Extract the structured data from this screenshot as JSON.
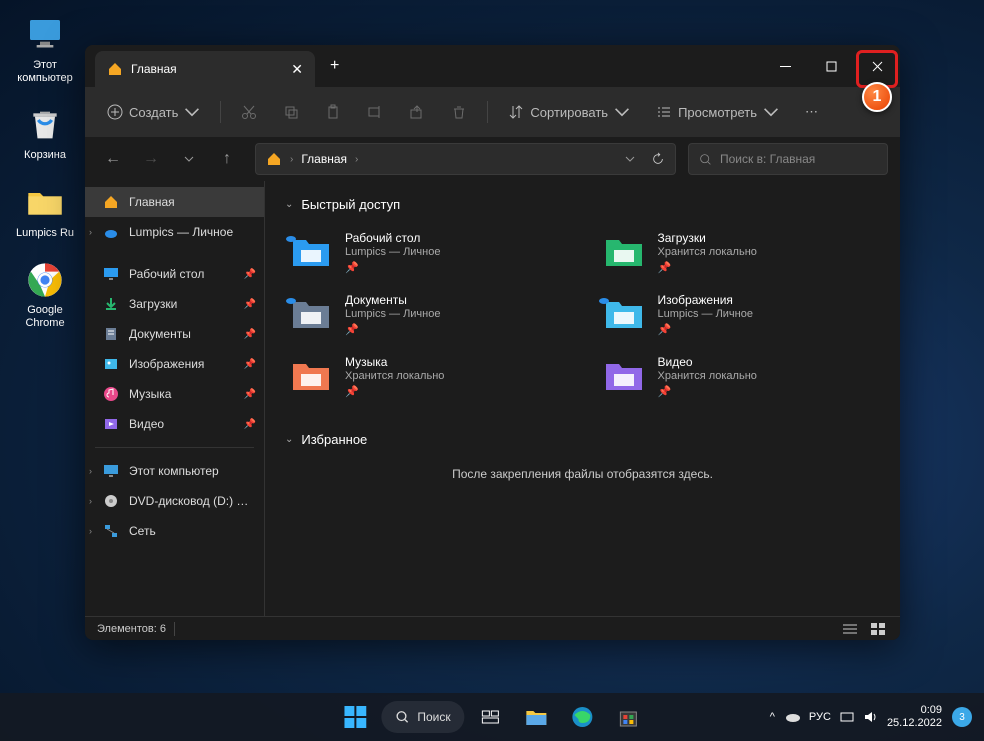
{
  "desktop": {
    "icons": [
      {
        "label": "Этот\nкомпьютер"
      },
      {
        "label": "Корзина"
      },
      {
        "label": "Lumpics Ru"
      },
      {
        "label": "Google\nChrome"
      }
    ]
  },
  "window": {
    "tab_title": "Главная",
    "toolbar": {
      "create": "Создать",
      "sort": "Сортировать",
      "view": "Просмотреть"
    },
    "breadcrumb": "Главная",
    "search_placeholder": "Поиск в: Главная",
    "status": "Элементов: 6"
  },
  "sidebar": {
    "home": "Главная",
    "onedrive": "Lumpics — Личное",
    "desktop": "Рабочий стол",
    "downloads": "Загрузки",
    "documents": "Документы",
    "pictures": "Изображения",
    "music": "Музыка",
    "videos": "Видео",
    "thispc": "Этот компьютер",
    "dvd": "DVD-дисковод (D:) ESD-IS",
    "network": "Сеть"
  },
  "sections": {
    "quick": "Быстрый доступ",
    "fav": "Избранное",
    "empty_fav": "После закрепления файлы отобразятся здесь."
  },
  "quick_items": [
    {
      "name": "Рабочий стол",
      "sub": "Lumpics — Личное",
      "color": "#2b9bf0",
      "cloud": true
    },
    {
      "name": "Загрузки",
      "sub": "Хранится локально",
      "color": "#27b76f"
    },
    {
      "name": "Документы",
      "sub": "Lumpics — Личное",
      "color": "#6b7d95",
      "cloud": true
    },
    {
      "name": "Изображения",
      "sub": "Lumpics — Личное",
      "color": "#3fb8ea",
      "cloud": true
    },
    {
      "name": "Музыка",
      "sub": "Хранится локально",
      "color": "#f07850"
    },
    {
      "name": "Видео",
      "sub": "Хранится локально",
      "color": "#9168e8"
    }
  ],
  "taskbar": {
    "search": "Поиск",
    "lang": "РУС",
    "time": "0:09",
    "date": "25.12.2022",
    "notif": "3"
  },
  "annotation": {
    "num": "1"
  }
}
